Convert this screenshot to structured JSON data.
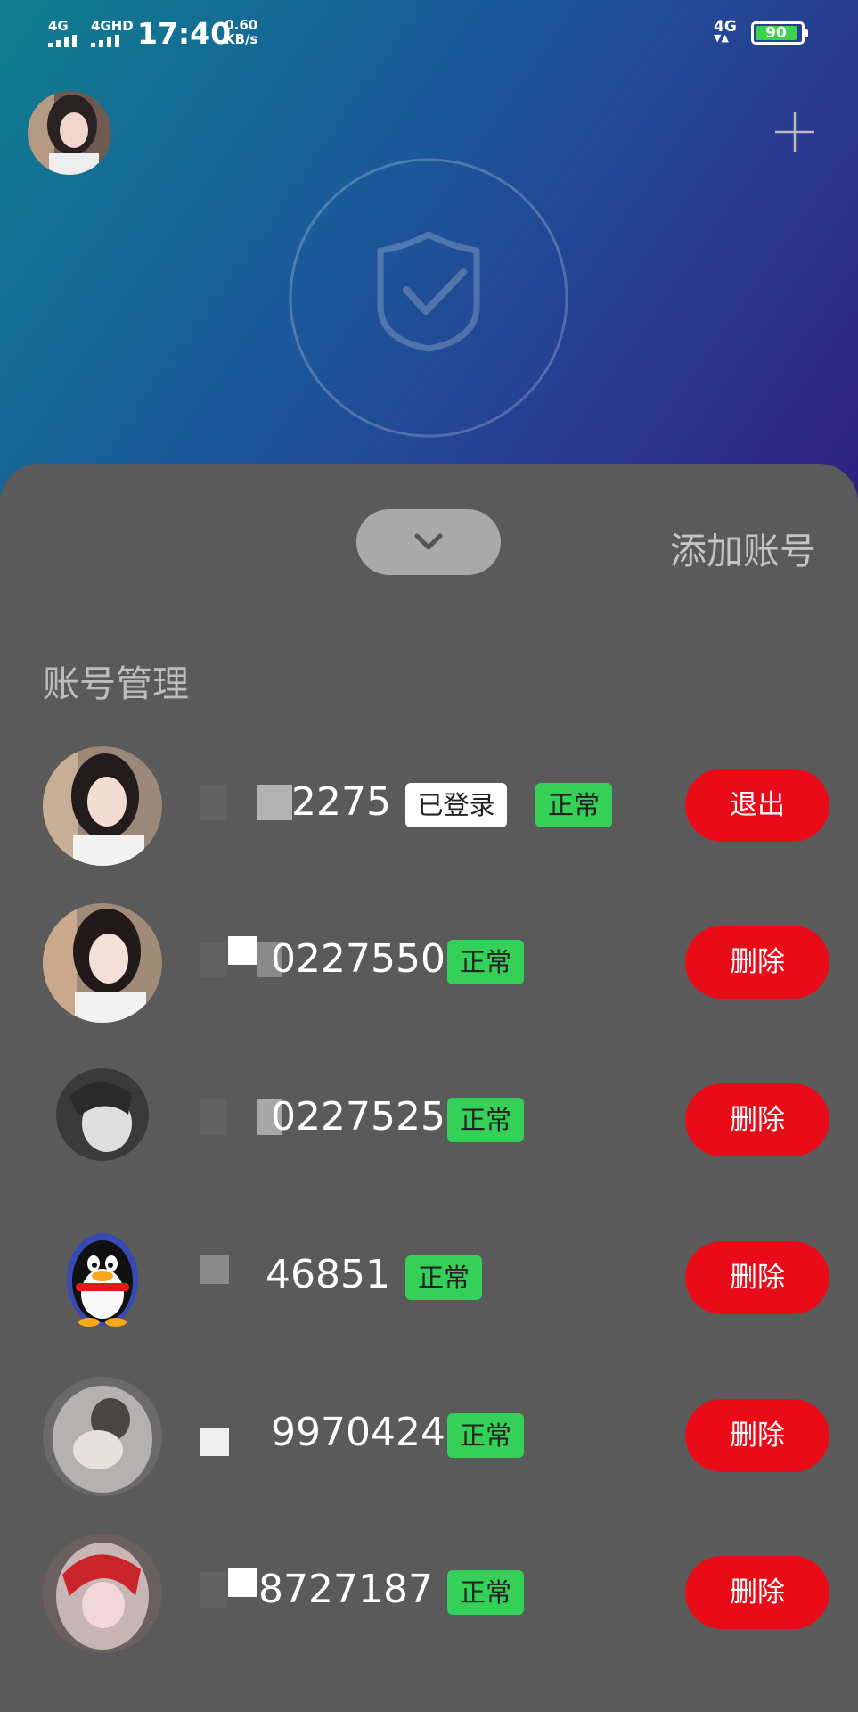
{
  "status_bar": {
    "sim1_label": "4G",
    "sim2_label": "4GHD",
    "time": "17:40",
    "net_speed_value": "0.60",
    "net_speed_unit": "KB/s",
    "network_label": "4G",
    "battery_level": "90",
    "battery_color": "#3cd34a"
  },
  "header": {
    "avatar": "profile-photo",
    "add_icon": "plus-icon",
    "center_icon": "shield-check-icon"
  },
  "sheet": {
    "collapse_icon": "chevron-down-icon",
    "add_account_label": "添加账号",
    "section_title": "账号管理"
  },
  "accounts": [
    {
      "number": "2275",
      "tags": [
        "已登录",
        "正常"
      ],
      "action": "退出"
    },
    {
      "number": "0227550",
      "tags": [
        "正常"
      ],
      "action": "删除"
    },
    {
      "number": "0227525",
      "tags": [
        "正常"
      ],
      "action": "删除"
    },
    {
      "number": "46851",
      "tags": [
        "正常"
      ],
      "action": "删除"
    },
    {
      "number": "9970424",
      "tags": [
        "正常"
      ],
      "action": "删除"
    },
    {
      "number": "8727187",
      "tags": [
        "正常"
      ],
      "action": "删除"
    }
  ],
  "colors": {
    "action_red": "#ea0b18",
    "status_green": "#34d058",
    "sheet_gray": "#5a5a5a"
  }
}
